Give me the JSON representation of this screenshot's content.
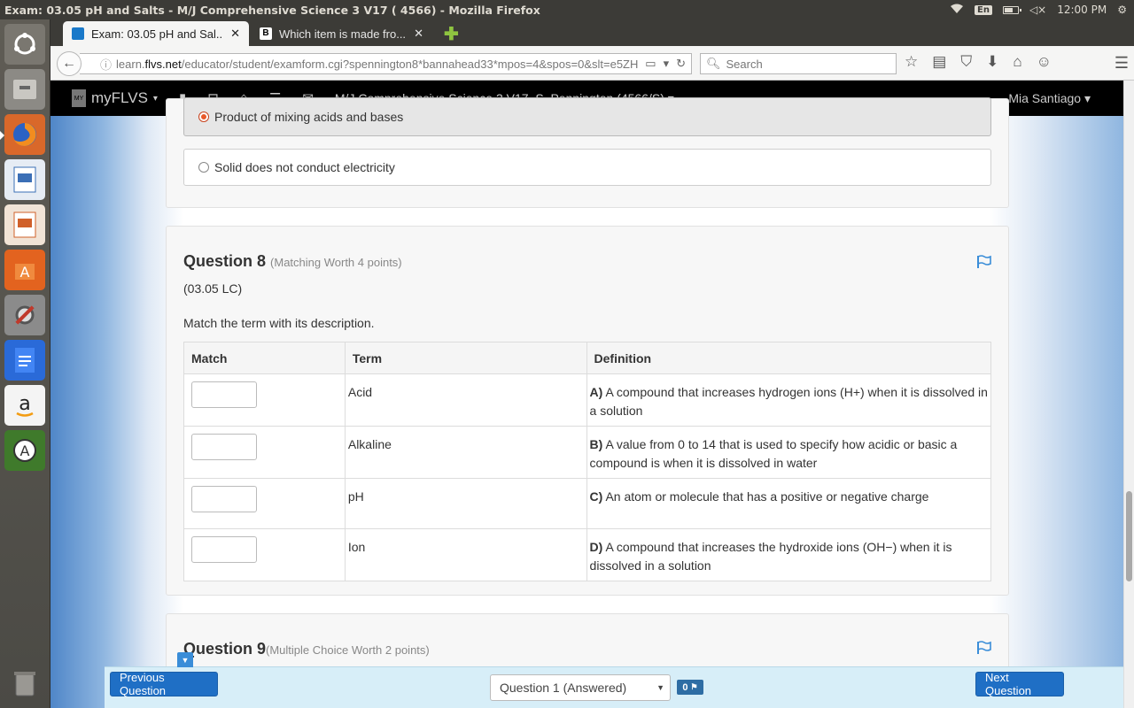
{
  "os": {
    "window_title": "Exam: 03.05 pH and Salts - M/J Comprehensive Science 3 V17 ( 4566) - Mozilla Firefox",
    "keyboard_layout": "En",
    "clock": "12:00 PM"
  },
  "launcher": {
    "items": [
      "ubuntu-dash-icon",
      "files-icon",
      "firefox-icon",
      "writer-icon",
      "impress-icon",
      "software-center-icon",
      "settings-icon",
      "docs-icon",
      "amazon-icon",
      "updater-icon",
      "trash-icon"
    ]
  },
  "browser": {
    "tabs": [
      {
        "title": "Exam: 03.05 pH and Sal...",
        "active": true
      },
      {
        "title": "Which item is made fro...",
        "active": false
      }
    ],
    "url_prefix": "learn.",
    "url_domain": "flvs.net",
    "url_path": "/educator/student/examform.cgi?spennington8*bannahead33*mpos=4&spos=0&slt=e5ZH",
    "search_placeholder": "Search"
  },
  "site": {
    "logo": "myFLVS",
    "course": "M/J Comprehensive Science 3 V17, S. Pennington (4566/S)",
    "user": "Mia Santiago"
  },
  "prev_question": {
    "options": [
      {
        "label": "Product of mixing acids and bases",
        "selected": true
      },
      {
        "label": "Solid does not conduct electricity",
        "selected": false
      }
    ]
  },
  "question8": {
    "title": "Question 8",
    "worth": "(Matching Worth 4 points)",
    "code": "(03.05 LC)",
    "prompt": "Match the term with its description.",
    "headers": [
      "Match",
      "Term",
      "Definition"
    ],
    "rows": [
      {
        "match": "",
        "term": "Acid",
        "letter": "A)",
        "definition": "A compound that increases hydrogen ions (H+) when it is dissolved in a solution"
      },
      {
        "match": "",
        "term": "Alkaline",
        "letter": "B)",
        "definition": "A value from 0 to 14 that is used to specify how acidic or basic a compound is when it is dissolved in water"
      },
      {
        "match": "",
        "term": "pH",
        "letter": "C)",
        "definition": "An atom or molecule that has a positive or negative charge"
      },
      {
        "match": "",
        "term": "Ion",
        "letter": "D)",
        "definition": "A compound that increases the hydroxide ions (OH−) when it is dissolved in a solution"
      }
    ]
  },
  "question9": {
    "title": "Question 9",
    "worth": "(Multiple Choice Worth 2 points)"
  },
  "footer": {
    "previous": "Previous Question",
    "next": "Next Question",
    "selected_question": "Question 1 (Answered)",
    "flag_count": "0"
  },
  "colors": {
    "accent": "#1f6fc5",
    "flag": "#3a8dd8",
    "radio_selected": "#e8592a"
  }
}
